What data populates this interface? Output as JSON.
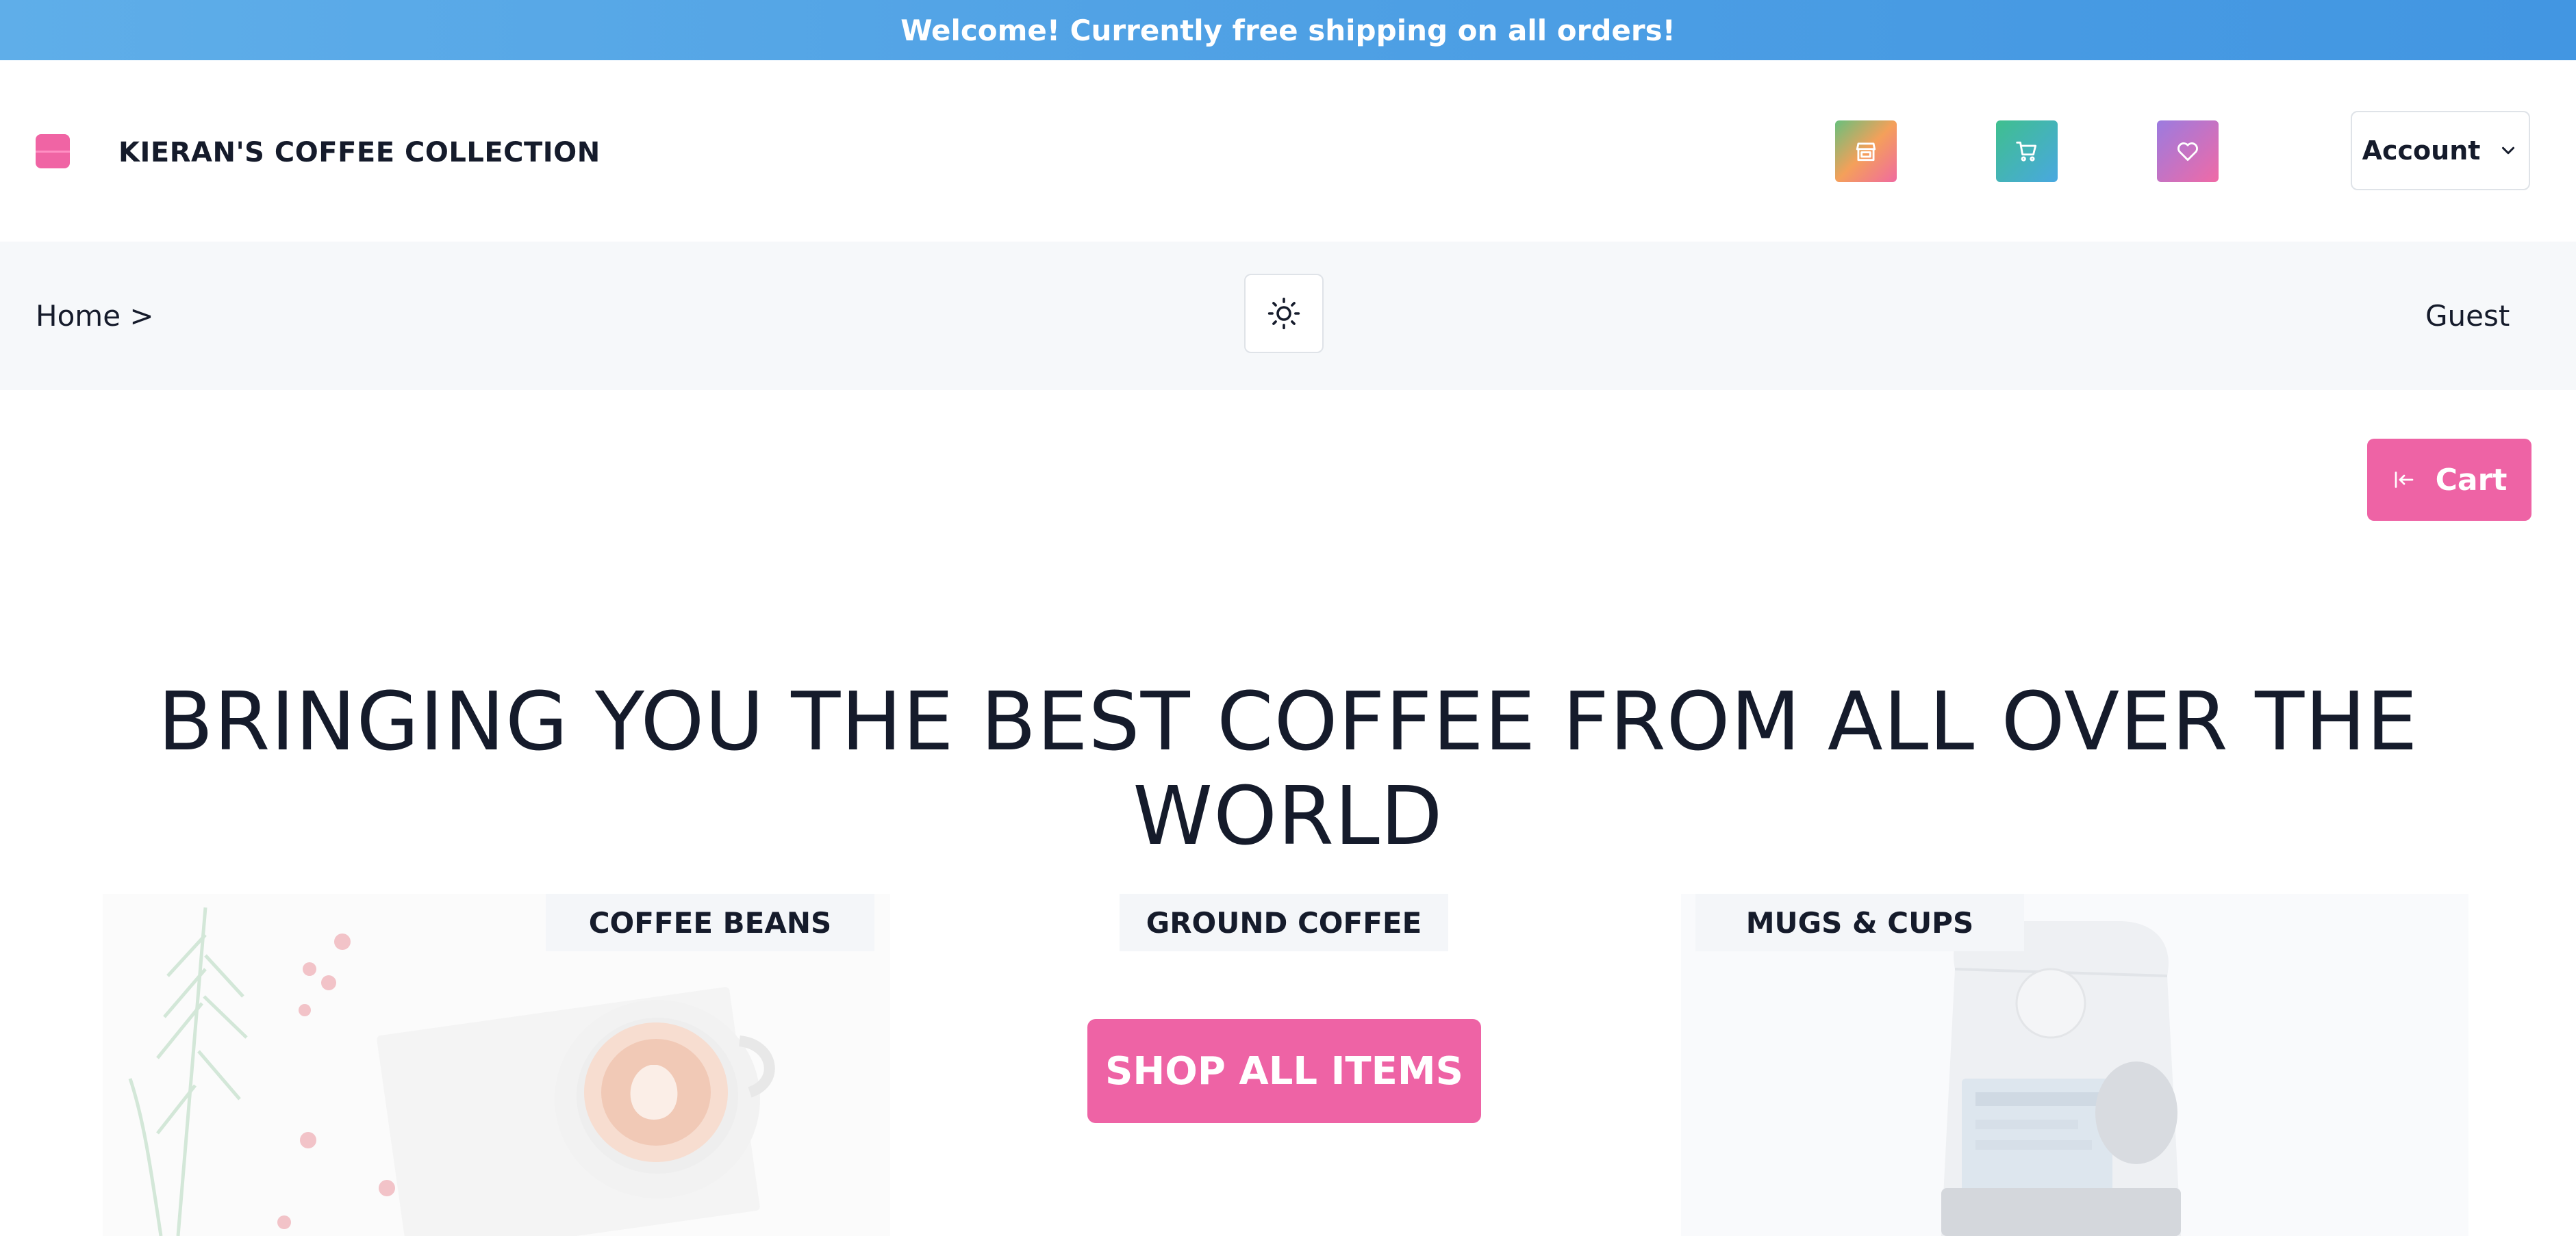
{
  "banner": {
    "text": "Welcome! Currently free shipping on all orders!"
  },
  "header": {
    "brand": "KIERAN'S COFFEE COLLECTION",
    "icons": [
      "store-icon",
      "shopping-cart-icon",
      "heart-icon"
    ],
    "account_label": "Account"
  },
  "subbar": {
    "breadcrumb": "Home >",
    "theme_icon": "sun-icon",
    "user": "Guest"
  },
  "cart_button": {
    "label": "Cart",
    "icon": "arrow-left-to-bar-icon"
  },
  "hero": {
    "title": "BRINGING YOU THE BEST COFFEE FROM ALL OVER THE WORLD"
  },
  "categories": [
    {
      "label": "COFFEE BEANS"
    },
    {
      "label": "GROUND COFFEE"
    },
    {
      "label": "MUGS & CUPS"
    }
  ],
  "shop_all": {
    "label": "SHOP ALL ITEMS"
  },
  "colors": {
    "banner": "#4d9fe4",
    "accent_pink": "#ee63a5",
    "subbar_bg": "#f6f8fa",
    "text": "#151b2b"
  }
}
